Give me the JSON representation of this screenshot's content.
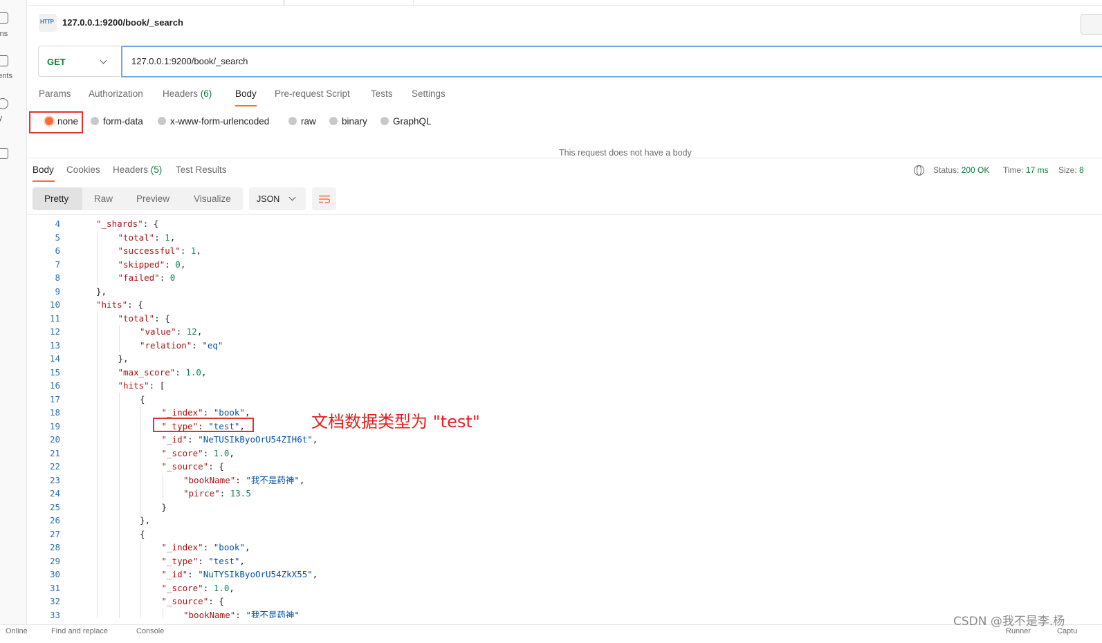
{
  "sidebar": {
    "items": [
      {
        "label": "tions",
        "icon": "collections-icon"
      },
      {
        "label": "ments",
        "icon": "environments-icon"
      },
      {
        "label": "ory",
        "icon": "history-icon"
      },
      {
        "label": "",
        "icon": "flows-icon"
      }
    ]
  },
  "request": {
    "title": "127.0.0.1:9200/book/_search",
    "badge": "HTTP",
    "method": "GET",
    "url": "127.0.0.1:9200/book/_search",
    "tabs": [
      {
        "label": "Params"
      },
      {
        "label": "Authorization"
      },
      {
        "label": "Headers",
        "count": "(6)"
      },
      {
        "label": "Body"
      },
      {
        "label": "Pre-request Script"
      },
      {
        "label": "Tests"
      },
      {
        "label": "Settings"
      }
    ],
    "active_tab": "Body",
    "body_types": [
      "none",
      "form-data",
      "x-www-form-urlencoded",
      "raw",
      "binary",
      "GraphQL"
    ],
    "selected_body_type": "none",
    "no_body_message": "This request does not have a body"
  },
  "response": {
    "tabs": [
      {
        "label": "Body"
      },
      {
        "label": "Cookies"
      },
      {
        "label": "Headers",
        "count": "(5)"
      },
      {
        "label": "Test Results"
      }
    ],
    "active_tab": "Body",
    "status_label": "Status:",
    "status_value": "200 OK",
    "time_label": "Time:",
    "time_value": "17 ms",
    "size_label": "Size:",
    "size_value": "8",
    "view_modes": [
      "Pretty",
      "Raw",
      "Preview",
      "Visualize"
    ],
    "active_view": "Pretty",
    "format": "JSON",
    "annotation": "文档数据类型为 \"test\"",
    "code_lines": [
      {
        "n": "4",
        "text": "\"_shards\": {"
      },
      {
        "n": "5",
        "text": "\"total\": 1,"
      },
      {
        "n": "6",
        "text": "\"successful\": 1,"
      },
      {
        "n": "7",
        "text": "\"skipped\": 0,"
      },
      {
        "n": "8",
        "text": "\"failed\": 0"
      },
      {
        "n": "9",
        "text": "},"
      },
      {
        "n": "10",
        "text": "\"hits\": {"
      },
      {
        "n": "11",
        "text": "\"total\": {"
      },
      {
        "n": "12",
        "text": "\"value\": 12,"
      },
      {
        "n": "13",
        "text": "\"relation\": \"eq\""
      },
      {
        "n": "14",
        "text": "},"
      },
      {
        "n": "15",
        "text": "\"max_score\": 1.0,"
      },
      {
        "n": "16",
        "text": "\"hits\": ["
      },
      {
        "n": "17",
        "text": "{"
      },
      {
        "n": "18",
        "text": "\"_index\": \"book\","
      },
      {
        "n": "19",
        "text": "\"_type\": \"test\","
      },
      {
        "n": "20",
        "text": "\"_id\": \"NeTUSIkByoOrU54ZIH6t\","
      },
      {
        "n": "21",
        "text": "\"_score\": 1.0,"
      },
      {
        "n": "22",
        "text": "\"_source\": {"
      },
      {
        "n": "23",
        "text": "\"bookName\": \"我不是药神\","
      },
      {
        "n": "24",
        "text": "\"pirce\": 13.5"
      },
      {
        "n": "25",
        "text": "}"
      },
      {
        "n": "26",
        "text": "},"
      },
      {
        "n": "27",
        "text": "{"
      },
      {
        "n": "28",
        "text": "\"_index\": \"book\","
      },
      {
        "n": "29",
        "text": "\"_type\": \"test\","
      },
      {
        "n": "30",
        "text": "\"_id\": \"NuTYSIkByoOrU54ZkX55\","
      },
      {
        "n": "31",
        "text": "\"_score\": 1.0,"
      },
      {
        "n": "32",
        "text": "\"_source\": {"
      },
      {
        "n": "33",
        "text": "\"bookName\": \"我不是药神\""
      }
    ]
  },
  "footer": {
    "online": "Online",
    "find_replace": "Find and replace",
    "console": "Console",
    "runner": "Runner",
    "capture": "Captu"
  },
  "watermark": "CSDN @我不是李.杨"
}
